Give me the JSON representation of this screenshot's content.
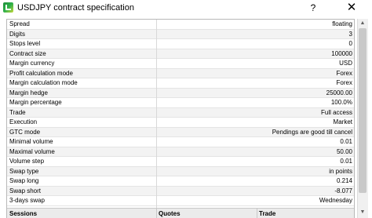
{
  "window": {
    "title": "USDJPY contract specification",
    "help_label": "?",
    "close_label": "✕"
  },
  "spec_rows": [
    {
      "label": "Spread",
      "value": "floating"
    },
    {
      "label": "Digits",
      "value": "3"
    },
    {
      "label": "Stops level",
      "value": "0"
    },
    {
      "label": "Contract size",
      "value": "100000"
    },
    {
      "label": "Margin currency",
      "value": "USD"
    },
    {
      "label": "Profit calculation mode",
      "value": "Forex"
    },
    {
      "label": "Margin calculation mode",
      "value": "Forex"
    },
    {
      "label": "Margin hedge",
      "value": "25000.00"
    },
    {
      "label": "Margin percentage",
      "value": "100.0%"
    },
    {
      "label": "Trade",
      "value": "Full access"
    },
    {
      "label": "Execution",
      "value": "Market"
    },
    {
      "label": "GTC mode",
      "value": "Pendings are good till cancel"
    },
    {
      "label": "Minimal volume",
      "value": "0.01"
    },
    {
      "label": "Maximal volume",
      "value": "50.00"
    },
    {
      "label": "Volume step",
      "value": "0.01"
    },
    {
      "label": "Swap type",
      "value": "in points"
    },
    {
      "label": "Swap long",
      "value": "0.214"
    },
    {
      "label": "Swap short",
      "value": "-8.077"
    },
    {
      "label": "3-days swap",
      "value": "Wednesday"
    }
  ],
  "sessions_header": {
    "col1": "Sessions",
    "col2": "Quotes",
    "col3": "Trade"
  }
}
